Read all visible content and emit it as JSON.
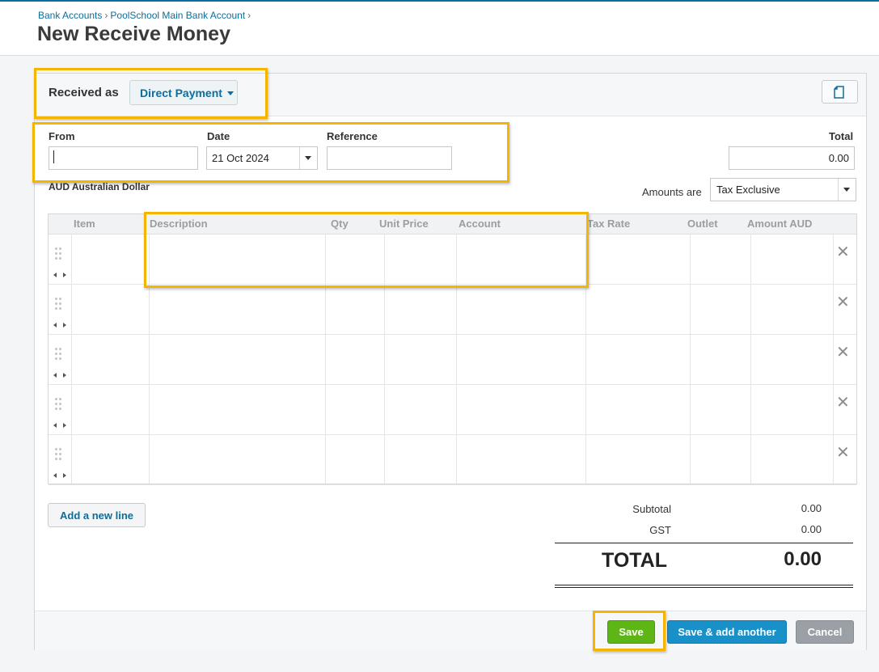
{
  "breadcrumb": {
    "item1": "Bank Accounts",
    "item2": "PoolSchool Main Bank Account",
    "sep": "›"
  },
  "page_title": "New Receive Money",
  "received_as": {
    "label": "Received as",
    "value": "Direct Payment"
  },
  "fields": {
    "from_label": "From",
    "from_value": "",
    "date_label": "Date",
    "date_value": "21 Oct 2024",
    "reference_label": "Reference",
    "reference_value": "",
    "total_label": "Total",
    "total_value": "0.00"
  },
  "currency": "AUD Australian Dollar",
  "amounts": {
    "label": "Amounts are",
    "value": "Tax Exclusive"
  },
  "columns": [
    "Item",
    "Description",
    "Qty",
    "Unit Price",
    "Account",
    "Tax Rate",
    "Outlet",
    "Amount AUD"
  ],
  "row_count": 5,
  "delete_glyph": "✕",
  "add_line_label": "Add a new line",
  "summary": {
    "subtotal_label": "Subtotal",
    "subtotal_value": "0.00",
    "gst_label": "GST",
    "gst_value": "0.00",
    "total_label": "TOTAL",
    "total_value": "0.00"
  },
  "footer": {
    "save": "Save",
    "save_add": "Save & add another",
    "cancel": "Cancel"
  },
  "colors": {
    "accent": "#0b6e9e",
    "save_green": "#5db616",
    "save_add_blue": "#1990c8",
    "cancel_grey": "#9aa0a5",
    "highlight": "#f4b400"
  }
}
